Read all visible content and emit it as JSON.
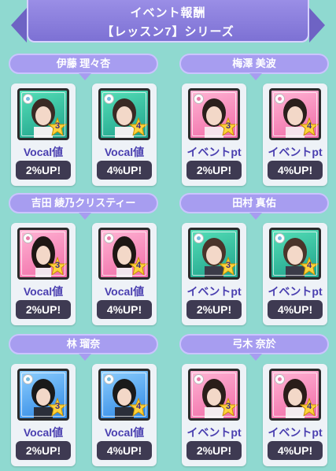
{
  "header": {
    "title": "イベント報酬",
    "subtitle": "【レッスン7】シリーズ"
  },
  "groups": [
    {
      "member": "伊藤 理々杏",
      "cards": [
        {
          "stat": "Vocal値",
          "bonus": "2%UP!",
          "level": "3",
          "frame": "green"
        },
        {
          "stat": "Vocal値",
          "bonus": "4%UP!",
          "level": "4",
          "frame": "green"
        }
      ]
    },
    {
      "member": "梅澤 美波",
      "cards": [
        {
          "stat": "イベントpt",
          "bonus": "2%UP!",
          "level": "3",
          "frame": "pink"
        },
        {
          "stat": "イベントpt",
          "bonus": "4%UP!",
          "level": "4",
          "frame": "pink"
        }
      ]
    },
    {
      "member": "吉田 綾乃クリスティー",
      "cards": [
        {
          "stat": "Vocal値",
          "bonus": "2%UP!",
          "level": "3",
          "frame": "pink"
        },
        {
          "stat": "Vocal値",
          "bonus": "4%UP!",
          "level": "4",
          "frame": "pink"
        }
      ]
    },
    {
      "member": "田村 真佑",
      "cards": [
        {
          "stat": "イベントpt",
          "bonus": "2%UP!",
          "level": "3",
          "frame": "green"
        },
        {
          "stat": "イベントpt",
          "bonus": "4%UP!",
          "level": "4",
          "frame": "green"
        }
      ]
    },
    {
      "member": "林 瑠奈",
      "cards": [
        {
          "stat": "Vocal値",
          "bonus": "2%UP!",
          "level": "3",
          "frame": "blue"
        },
        {
          "stat": "Vocal値",
          "bonus": "4%UP!",
          "level": "4",
          "frame": "blue"
        }
      ]
    },
    {
      "member": "弓木 奈於",
      "cards": [
        {
          "stat": "イベントpt",
          "bonus": "2%UP!",
          "level": "3",
          "frame": "pink"
        },
        {
          "stat": "イベントpt",
          "bonus": "4%UP!",
          "level": "4",
          "frame": "pink"
        }
      ]
    }
  ],
  "colors": {
    "background": "#8fd9d0",
    "banner": "#8a7fe0",
    "name_pill": "#a79df0",
    "stat_text": "#4a3fb0",
    "bonus_bg": "#3e3a52"
  },
  "icons": {
    "rank_star": "star-icon",
    "attribute": "attribute-icon",
    "portrait": "member-portrait-icon"
  }
}
